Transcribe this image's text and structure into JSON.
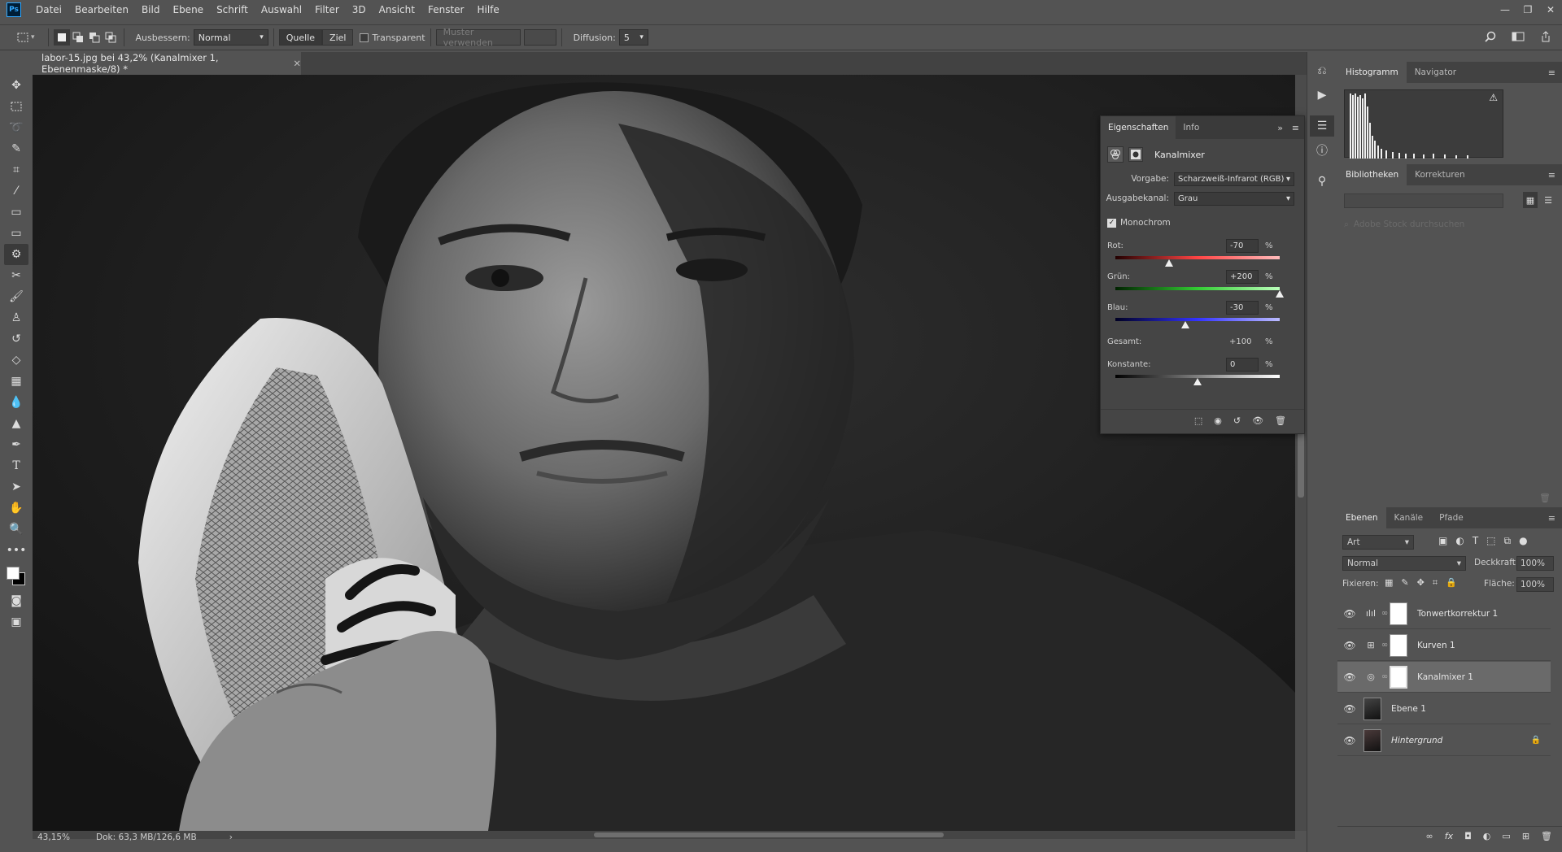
{
  "app": {
    "logo": "Ps",
    "menu": [
      "Datei",
      "Bearbeiten",
      "Bild",
      "Ebene",
      "Schrift",
      "Auswahl",
      "Filter",
      "3D",
      "Ansicht",
      "Fenster",
      "Hilfe"
    ]
  },
  "options": {
    "ausbessern_label": "Ausbessern:",
    "ausbessern_value": "Normal",
    "quelle": "Quelle",
    "ziel": "Ziel",
    "transparent": "Transparent",
    "muster": "Muster verwenden",
    "diffusion_label": "Diffusion:",
    "diffusion_value": "5"
  },
  "document": {
    "tab_title": "labor-15.jpg bei 43,2% (Kanalmixer 1, Ebenenmaske/8) *",
    "zoom": "43,15%",
    "doc_info": "Dok: 63,3 MB/126,6 MB"
  },
  "properties": {
    "tab_active": "Eigenschaften",
    "tab_info": "Info",
    "title": "Kanalmixer",
    "vorgabe_label": "Vorgabe:",
    "vorgabe_value": "Scharzweiß-Infrarot (RGB)",
    "ausgabe_label": "Ausgabekanal:",
    "ausgabe_value": "Grau",
    "monochrom": "Monochrom",
    "rot_label": "Rot:",
    "rot_value": "-70",
    "gruen_label": "Grün:",
    "gruen_value": "+200",
    "blau_label": "Blau:",
    "blau_value": "-30",
    "gesamt_label": "Gesamt:",
    "gesamt_value": "+100",
    "konstante_label": "Konstante:",
    "konstante_value": "0",
    "percent": "%",
    "slider_levels": {
      "rot": -70,
      "gruen": 200,
      "blau": -30,
      "konstante": 0
    }
  },
  "histogram": {
    "tab_active": "Histogramm",
    "tab_other": "Navigator"
  },
  "libraries": {
    "tab_active": "Bibliotheken",
    "tab_other": "Korrekturen",
    "search_placeholder": "Adobe Stock durchsuchen"
  },
  "layers": {
    "tabs": [
      "Ebenen",
      "Kanäle",
      "Pfade"
    ],
    "filter": "Art",
    "blend": "Normal",
    "opacity_label": "Deckkraft:",
    "opacity": "100%",
    "lock_label": "Fixieren:",
    "fill_label": "Fläche:",
    "fill": "100%",
    "items": [
      "Tonwertkorrektur 1",
      "Kurven 1",
      "Kanalmixer 1",
      "Ebene 1",
      "Hintergrund"
    ]
  },
  "colors": {
    "accent": "#31a8ff",
    "panel": "#535353",
    "dark": "#3a3a3a"
  }
}
